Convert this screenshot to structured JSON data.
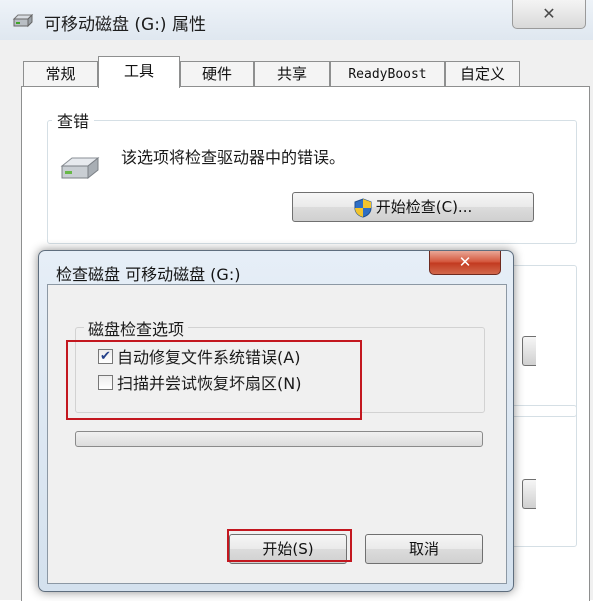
{
  "window": {
    "title": "可移动磁盘 (G:) 属性",
    "close_glyph": "✕",
    "icon": "removable-drive-icon"
  },
  "tabs": [
    {
      "label": "常规",
      "active": false
    },
    {
      "label": "工具",
      "active": true
    },
    {
      "label": "硬件",
      "active": false
    },
    {
      "label": "共享",
      "active": false
    },
    {
      "label": "ReadyBoost",
      "active": false
    },
    {
      "label": "自定义",
      "active": false
    }
  ],
  "error_check": {
    "group_title": "查错",
    "description": "该选项将检查驱动器中的错误。",
    "button_label": "开始检查(C)...",
    "icon": "hard-drive-icon",
    "button_icon": "uac-shield-icon"
  },
  "dialog": {
    "title": "检查磁盘 可移动磁盘 (G:)",
    "close_glyph": "✕",
    "options_title": "磁盘检查选项",
    "options": [
      {
        "label": "自动修复文件系统错误(A)",
        "checked": true
      },
      {
        "label": "扫描并尝试恢复坏扇区(N)",
        "checked": false
      }
    ],
    "progress_fraction": 0,
    "start_button": "开始(S)",
    "cancel_button": "取消"
  },
  "colors": {
    "highlight_border": "#c3171f",
    "dialog_close": "#c23a20",
    "panel": "#ffffff",
    "window_bg": "#f0f0f0"
  }
}
